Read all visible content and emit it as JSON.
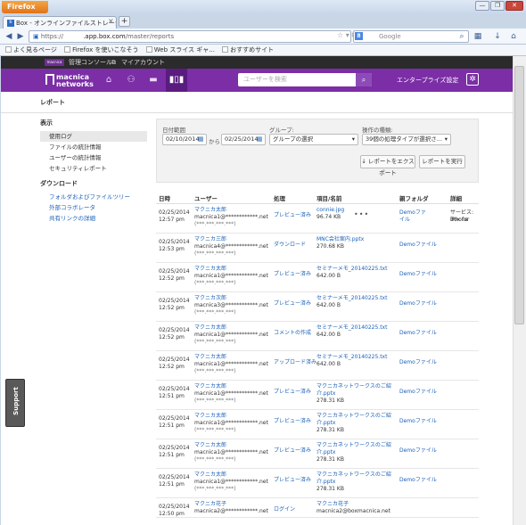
{
  "browser": {
    "app_button": "Firefox",
    "tab_title": "Box - オンラインファイルストレージ...",
    "tab_close": "×",
    "new_tab": "+",
    "url_prefix": "https://",
    "url_host": ".app.box.com",
    "url_path": "/master/reports",
    "search_engine_badge": "8",
    "search_placeholder": "Google",
    "bookmarks": [
      "よく見るページ",
      "Firefox を使いこなそう",
      "Web スライス ギャ...",
      "おすすめサイト"
    ],
    "window_controls": [
      "—",
      "❐",
      "✕"
    ]
  },
  "app": {
    "admin_bar": {
      "logo_text": "macnica",
      "console": "管理コンソール",
      "my_account": "マイアカウント"
    },
    "logo": {
      "line1": "macnica",
      "line2": "networks"
    },
    "search_placeholder": "ユーザーを検索",
    "enterprise_settings": "エンタープライズ設定",
    "page_title": "レポート"
  },
  "sidebar": {
    "display_heading": "表示",
    "display_items": [
      "使用ログ",
      "ファイルの統計情報",
      "ユーザーの統計情報",
      "セキュリティレポート"
    ],
    "download_heading": "ダウンロード",
    "download_items": [
      "フォルダおよびファイルツリー",
      "外部コラボレータ",
      "共有リンクの詳細"
    ]
  },
  "filters": {
    "date_range_label": "日付範囲",
    "date_from": "02/10/2014",
    "date_sep": "から",
    "date_to": "02/25/2014",
    "group_label": "グループ:",
    "group_value": "グループの選択",
    "action_type_label": "操作の種類:",
    "action_type_value": "39個の処理タイプが選択さ...",
    "export_button": "レポートをエクスポート",
    "run_button": "レポートを実行"
  },
  "table": {
    "headers": {
      "date": "日時",
      "user": "ユーザー",
      "action": "処理",
      "item": "項目/名前",
      "folder": "親フォルダ",
      "detail": "詳細"
    },
    "rows": [
      {
        "date": "02/25/2014",
        "time": "12:57 pm",
        "user": "マクニカ太郎",
        "email": "macnica1@************.net",
        "ip": "(***.***.***.***)",
        "action": "プレビュー済み",
        "item": "connie.jpg",
        "size": "96.74 KB",
        "folder": "Demoファ",
        "folder2": "イル",
        "detail": "サービス: Box for",
        "detail2": "iPhone"
      },
      {
        "date": "02/25/2014",
        "time": "12:53 pm",
        "user": "マクニカ三郎",
        "email": "macnica4@************.net",
        "ip": "(***.***.***.***)",
        "action": "ダウンロード",
        "item": "MNC会社案内.pptx",
        "size": "270.68 KB",
        "folder": "Demoファイル",
        "folder2": "",
        "detail": "",
        "detail2": ""
      },
      {
        "date": "02/25/2014",
        "time": "12:52 pm",
        "user": "マクニカ太郎",
        "email": "macnica1@************.net",
        "ip": "(***.***.***.***)",
        "action": "プレビュー済み",
        "item": "セミナーメモ_20140225.txt",
        "size": "642.00 B",
        "folder": "Demoファイル",
        "folder2": "",
        "detail": "",
        "detail2": ""
      },
      {
        "date": "02/25/2014",
        "time": "12:52 pm",
        "user": "マクニカ次郎",
        "email": "macnica3@************.net",
        "ip": "(***.***.***.***)",
        "action": "プレビュー済み",
        "item": "セミナーメモ_20140225.txt",
        "size": "642.00 B",
        "folder": "Demoファイル",
        "folder2": "",
        "detail": "",
        "detail2": ""
      },
      {
        "date": "02/25/2014",
        "time": "12:52 pm",
        "user": "マクニカ太郎",
        "email": "macnica1@************.net",
        "ip": "(***.***.***.***)",
        "action": "コメントの作成",
        "item": "セミナーメモ_20140225.txt",
        "size": "642.00 B",
        "folder": "Demoファイル",
        "folder2": "",
        "detail": "",
        "detail2": ""
      },
      {
        "date": "02/25/2014",
        "time": "12:52 pm",
        "user": "マクニカ太郎",
        "email": "macnica1@************.net",
        "ip": "(***.***.***.***)",
        "action": "アップロード済み",
        "item": "セミナーメモ_20140225.txt",
        "size": "642.00 B",
        "folder": "Demoファイル",
        "folder2": "",
        "detail": "",
        "detail2": ""
      },
      {
        "date": "02/25/2014",
        "time": "12:51 pm",
        "user": "マクニカ太郎",
        "email": "macnica1@************.net",
        "ip": "(***.***.***.***)",
        "action": "プレビュー済み",
        "item": "マクニカネットワークスのご紹",
        "item2": "介.pptx",
        "size": "278.31 KB",
        "folder": "Demoファイル",
        "folder2": "",
        "detail": "",
        "detail2": ""
      },
      {
        "date": "02/25/2014",
        "time": "12:51 pm",
        "user": "マクニカ太郎",
        "email": "macnica1@************.net",
        "ip": "(***.***.***.***)",
        "action": "プレビュー済み",
        "item": "マクニカネットワークスのご紹",
        "item2": "介.pptx",
        "size": "278.31 KB",
        "folder": "Demoファイル",
        "folder2": "",
        "detail": "",
        "detail2": ""
      },
      {
        "date": "02/25/2014",
        "time": "12:51 pm",
        "user": "マクニカ太郎",
        "email": "macnica1@************.net",
        "ip": "(***.***.***.***)",
        "action": "プレビュー済み",
        "item": "マクニカネットワークスのご紹",
        "item2": "介.pptx",
        "size": "278.31 KB",
        "folder": "Demoファイル",
        "folder2": "",
        "detail": "",
        "detail2": ""
      },
      {
        "date": "02/25/2014",
        "time": "12:51 pm",
        "user": "マクニカ太郎",
        "email": "macnica1@************.net",
        "ip": "(***.***.***.***)",
        "action": "プレビュー済み",
        "item": "マクニカネットワークスのご紹",
        "item2": "介.pptx",
        "size": "278.31 KB",
        "folder": "Demoファイル",
        "folder2": "",
        "detail": "",
        "detail2": ""
      },
      {
        "date": "02/25/2014",
        "time": "12:50 pm",
        "user": "マクニカ花子",
        "email": "macnica2@************.net",
        "ip": "",
        "action": "ログイン",
        "item": "マクニカ花子",
        "size": "macnica2@boxmacnica.net",
        "folder": "",
        "folder2": "",
        "detail": "",
        "detail2": ""
      }
    ],
    "more_label": "•••"
  },
  "support_tab": "Support",
  "colors": {
    "brand_purple": "#7b2ea6",
    "link_blue": "#1a61b8"
  }
}
